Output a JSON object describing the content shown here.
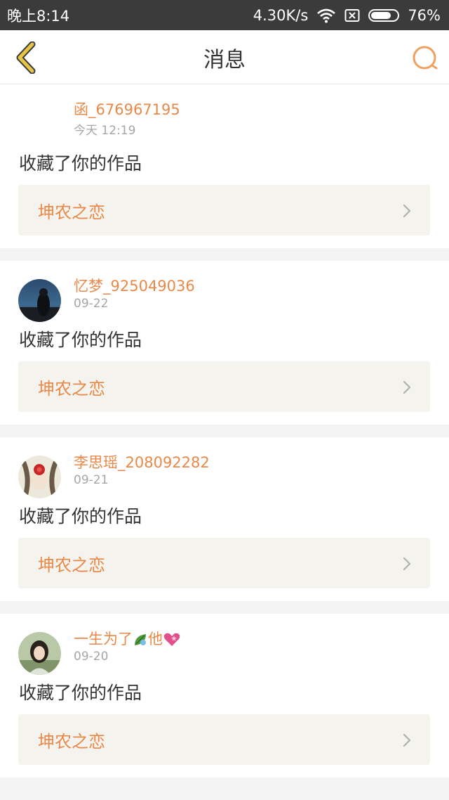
{
  "status_bar": {
    "time": "晚上8:14",
    "network_speed": "4.30K/s",
    "battery_percent": "76%",
    "battery_level": 0.76
  },
  "header": {
    "title": "消息",
    "back_icon": "chevron-left-icon",
    "search_icon": "search-icon"
  },
  "colors": {
    "accent": "#e8894a",
    "back_icon": "#e8c547",
    "card_link_bg": "#f4f3ed"
  },
  "messages": [
    {
      "user": "函_676967195",
      "date": "今天 12:19",
      "action": "收藏了你的作品",
      "work_title": "坤农之恋",
      "avatar": "none"
    },
    {
      "user": "忆梦_925049036",
      "date": "09-22",
      "action": "收藏了你的作品",
      "work_title": "坤农之恋",
      "avatar": "night-sky-avatar"
    },
    {
      "user": "李思瑶_208092282",
      "date": "09-21",
      "action": "收藏了你的作品",
      "work_title": "坤农之恋",
      "avatar": "red-flower-avatar"
    },
    {
      "user_prefix": "一生为了",
      "user_suffix": "他",
      "user_emojis": [
        "leaf-emoji",
        "heart-emoji"
      ],
      "date": "09-20",
      "action": "收藏了你的作品",
      "work_title": "坤农之恋",
      "avatar": "girl-portrait-avatar"
    }
  ]
}
